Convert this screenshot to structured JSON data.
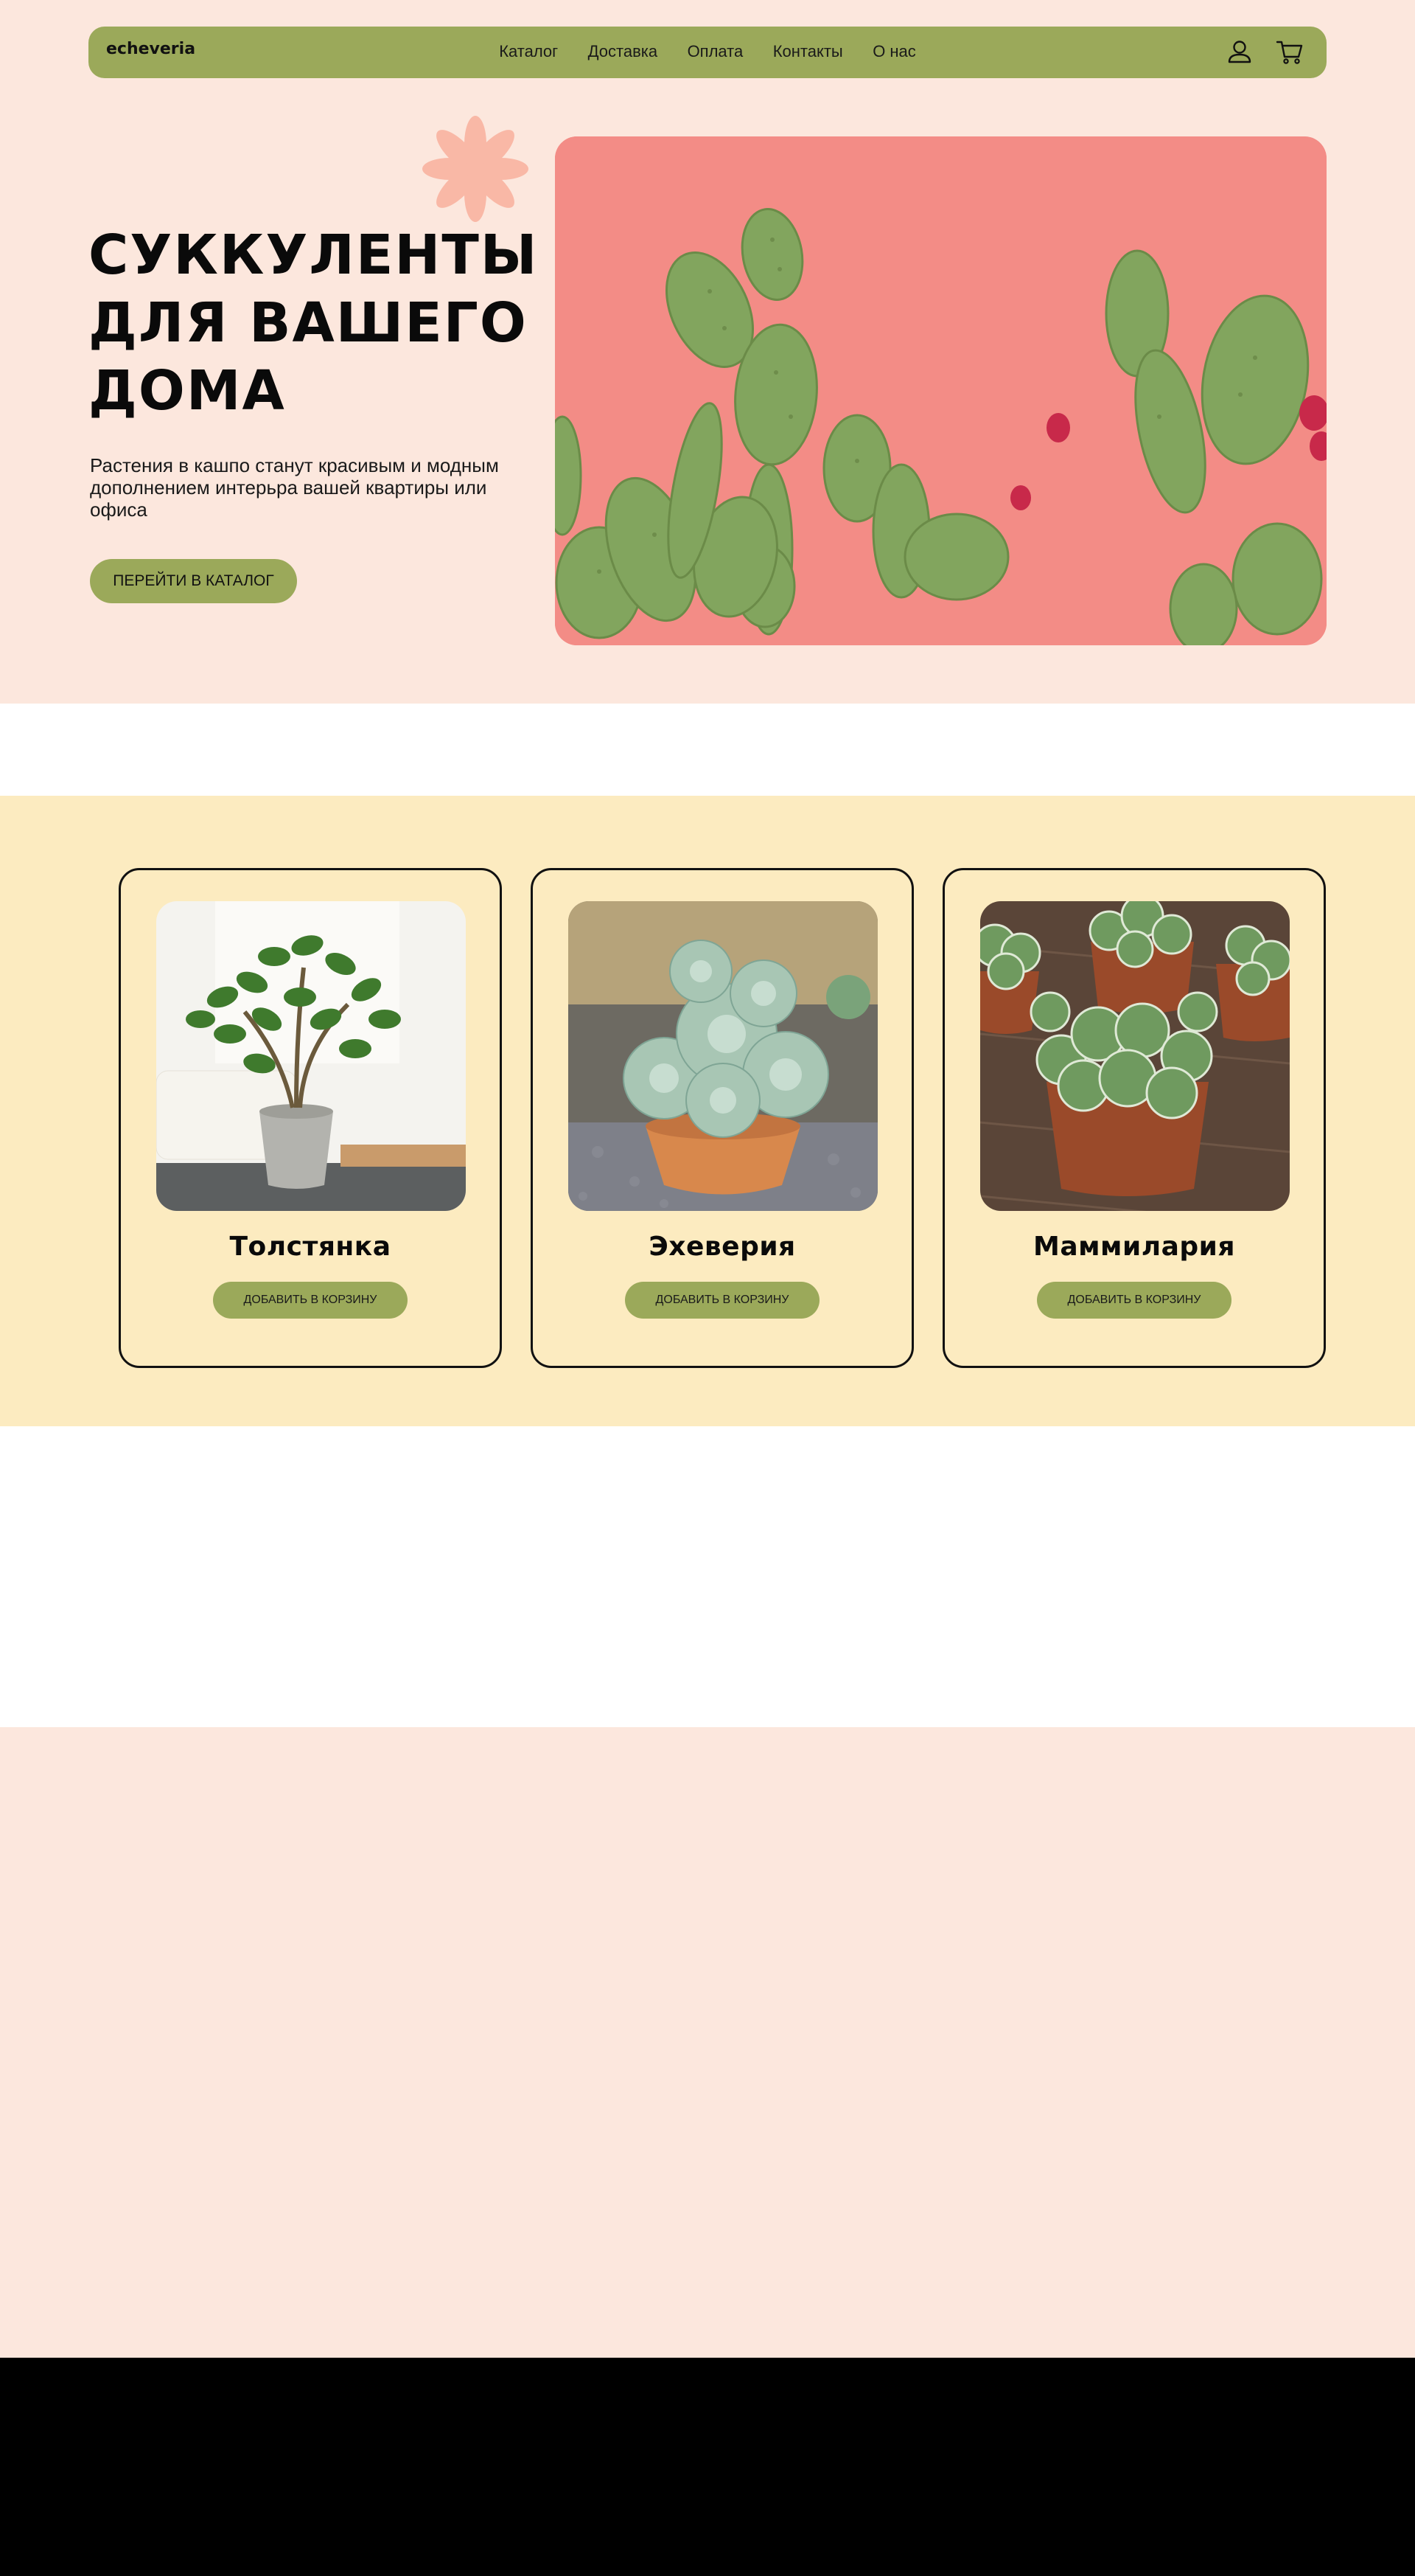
{
  "header": {
    "logo": "echeveria",
    "nav": [
      "Каталог",
      "Доставка",
      "Оплата",
      "Контакты",
      "О нас"
    ],
    "icons": [
      "user-icon",
      "cart-icon"
    ]
  },
  "hero": {
    "title_lines": [
      "СУККУЛЕНТЫ",
      "ДЛЯ ВАШЕГО",
      "ДОМА"
    ],
    "description": "Растения в кашпо станут красивым и модным дополнением интерьра вашей квартиры или офиса",
    "cta_label": "ПЕРЕЙТИ В КАТАЛОГ"
  },
  "products": [
    {
      "name": "Толстянка",
      "button": "ДОБАВИТЬ В КОРЗИНУ"
    },
    {
      "name": "Эхеверия",
      "button": "ДОБАВИТЬ В КОРЗИНУ"
    },
    {
      "name": "Маммилария",
      "button": "ДОБАВИТЬ В КОРЗИНУ"
    }
  ],
  "colors": {
    "accent": "#9ba95a",
    "hero_bg": "#fce7dd",
    "products_bg": "#fcebc0",
    "flower": "#f9b8a6",
    "footer_bg": "#000000"
  }
}
